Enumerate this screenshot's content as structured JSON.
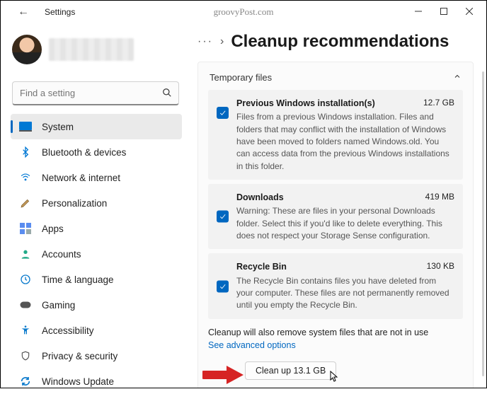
{
  "window": {
    "title": "Settings",
    "watermark": "groovyPost.com"
  },
  "search": {
    "placeholder": "Find a setting"
  },
  "sidebar": {
    "items": [
      {
        "label": "System",
        "icon": "system",
        "active": true
      },
      {
        "label": "Bluetooth & devices",
        "icon": "bluetooth"
      },
      {
        "label": "Network & internet",
        "icon": "wifi"
      },
      {
        "label": "Personalization",
        "icon": "brush"
      },
      {
        "label": "Apps",
        "icon": "apps"
      },
      {
        "label": "Accounts",
        "icon": "account"
      },
      {
        "label": "Time & language",
        "icon": "time"
      },
      {
        "label": "Gaming",
        "icon": "gaming"
      },
      {
        "label": "Accessibility",
        "icon": "accessibility"
      },
      {
        "label": "Privacy & security",
        "icon": "privacy"
      },
      {
        "label": "Windows Update",
        "icon": "update"
      }
    ]
  },
  "page": {
    "breadcrumb_more": "···",
    "title": "Cleanup recommendations",
    "section": "Temporary files",
    "items": [
      {
        "name": "Previous Windows installation(s)",
        "size": "12.7 GB",
        "desc": "Files from a previous Windows installation.  Files and folders that may conflict with the installation of Windows have been moved to folders named Windows.old.  You can access data from the previous Windows installations in this folder.",
        "checked": true
      },
      {
        "name": "Downloads",
        "size": "419 MB",
        "desc": "Warning: These are files in your personal Downloads folder. Select this if you'd like to delete everything. This does not respect your Storage Sense configuration.",
        "checked": true
      },
      {
        "name": "Recycle Bin",
        "size": "130 KB",
        "desc": "The Recycle Bin contains files you have deleted from your computer. These files are not permanently removed until you empty the Recycle Bin.",
        "checked": true
      }
    ],
    "note": "Cleanup will also remove system files that are not in use",
    "advanced": "See advanced options",
    "button": "Clean up 13.1 GB"
  }
}
